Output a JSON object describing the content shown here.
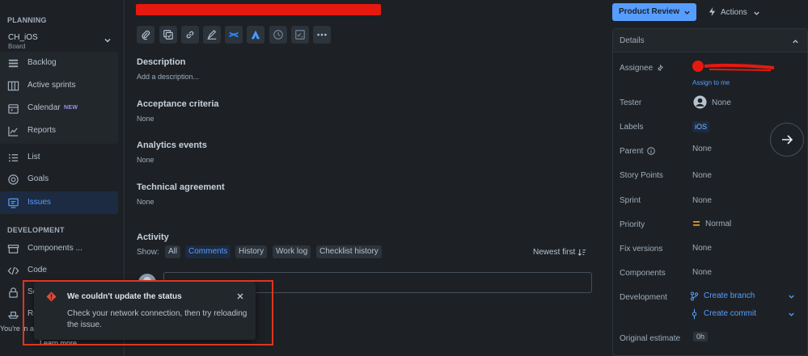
{
  "sidebar": {
    "planning_label": "PLANNING",
    "project": {
      "name": "CH_iOS",
      "type": "Board"
    },
    "items": [
      {
        "label": "Backlog",
        "icon": "backlog-icon"
      },
      {
        "label": "Active sprints",
        "icon": "columns-icon"
      },
      {
        "label": "Calendar",
        "icon": "calendar-icon",
        "badge": "NEW"
      },
      {
        "label": "Reports",
        "icon": "chart-icon"
      }
    ],
    "items2": [
      {
        "label": "List",
        "icon": "list-icon"
      },
      {
        "label": "Goals",
        "icon": "target-icon"
      },
      {
        "label": "Issues",
        "icon": "issues-icon",
        "active": true
      }
    ],
    "development_label": "DEVELOPMENT",
    "dev_items": [
      {
        "label": "Components ...",
        "icon": "component-icon"
      },
      {
        "label": "Code",
        "icon": "code-icon"
      },
      {
        "label": "Se",
        "icon": "lock-icon"
      },
      {
        "label": "Re",
        "icon": "ship-icon"
      }
    ],
    "footer_text": "You're in a c",
    "learn_more": "Learn more"
  },
  "toolbar": {
    "icons": [
      "attachment-icon",
      "subtask-icon",
      "link-icon",
      "pen-icon",
      "confluence-icon",
      "atlassian-icon",
      "clock-icon",
      "checklist-icon",
      "more-icon"
    ]
  },
  "issue": {
    "description_title": "Description",
    "description_placeholder": "Add a description...",
    "acceptance_title": "Acceptance criteria",
    "acceptance_value": "None",
    "analytics_title": "Analytics events",
    "analytics_value": "None",
    "technical_title": "Technical agreement",
    "technical_value": "None"
  },
  "activity": {
    "title": "Activity",
    "show_label": "Show:",
    "filters": [
      "All",
      "Comments",
      "History",
      "Work log",
      "Checklist history"
    ],
    "selected_filter": "Comments",
    "sort_label": "Newest first"
  },
  "header": {
    "status_button": "Product Review",
    "actions_button": "Actions"
  },
  "details": {
    "title": "Details",
    "assignee_label": "Assignee",
    "assign_to_me": "Assign to me",
    "tester_label": "Tester",
    "tester_value": "None",
    "labels_label": "Labels",
    "labels_value": "iOS",
    "parent_label": "Parent",
    "parent_value": "None",
    "story_points_label": "Story Points",
    "story_points_value": "None",
    "sprint_label": "Sprint",
    "sprint_value": "None",
    "priority_label": "Priority",
    "priority_value": "Normal",
    "fix_versions_label": "Fix versions",
    "fix_versions_value": "None",
    "components_label": "Components",
    "components_value": "None",
    "development_label": "Development",
    "create_branch": "Create branch",
    "create_commit": "Create commit",
    "original_estimate_label": "Original estimate",
    "original_estimate_value": "0h"
  },
  "toast": {
    "title": "We couldn't update the status",
    "message": "Check your network connection, then try reloading the issue."
  },
  "colors": {
    "background": "#1d2125",
    "accent": "#579dff",
    "error": "#e34935",
    "redaction": "#e6190f",
    "annotation_box": "#e03520"
  }
}
